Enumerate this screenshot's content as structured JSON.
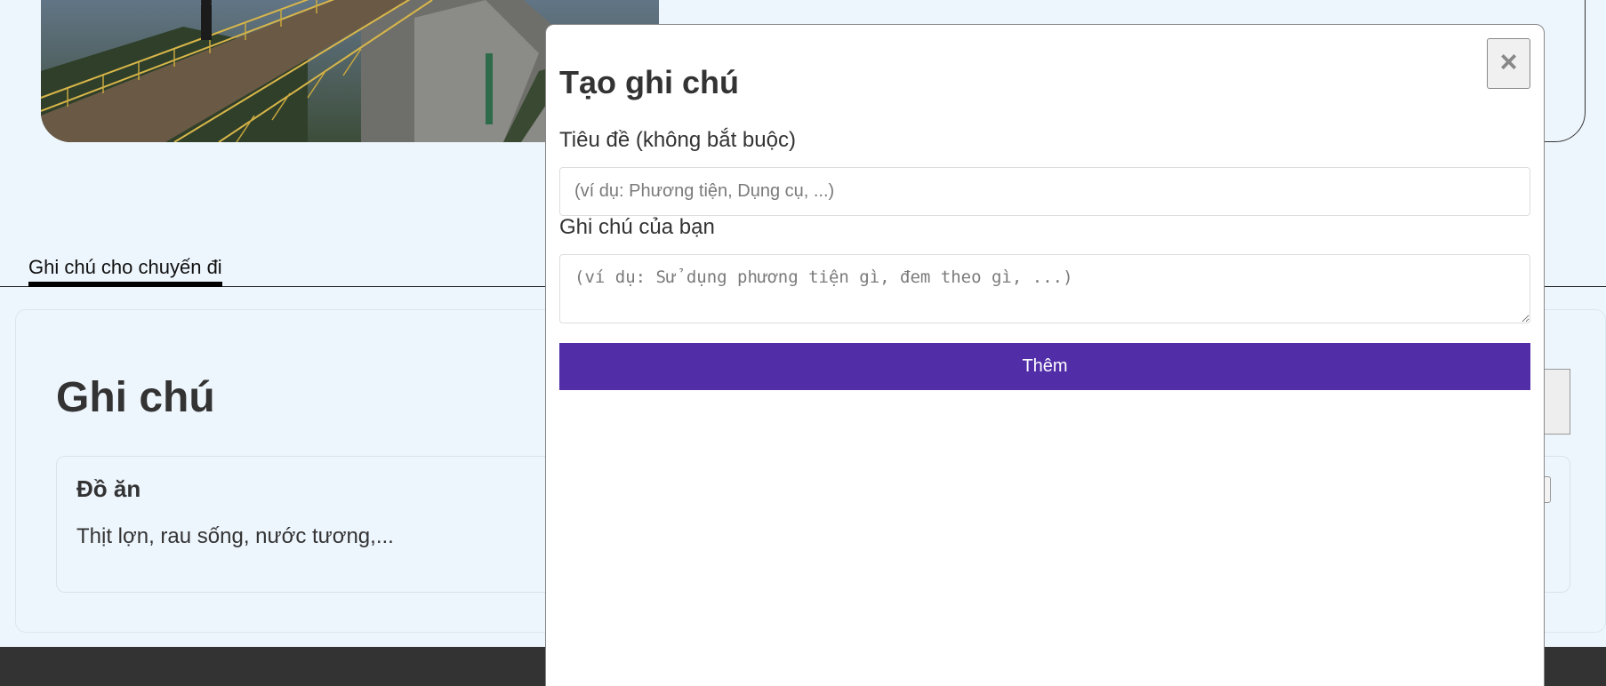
{
  "colors": {
    "page_background": "#eef6fd",
    "primary_button": "#512da8",
    "footer": "#333333",
    "text": "#333333"
  },
  "tabs": [
    {
      "label": "Ghi chú cho chuyến đi",
      "active": true
    }
  ],
  "notes": {
    "heading": "Ghi chú",
    "items": [
      {
        "title": "Đồ ăn",
        "body": "Thịt lợn, rau sống, nước tương,..."
      }
    ]
  },
  "modal": {
    "title": "Tạo ghi chú",
    "close_icon": "×",
    "title_field": {
      "label": "Tiêu đề (không bắt buộc)",
      "value": "",
      "placeholder": "(ví dụ: Phương tiện, Dụng cụ, ...)"
    },
    "note_field": {
      "label": "Ghi chú của bạn",
      "value": "",
      "placeholder": "(ví dụ: Sử dụng phương tiện gì, đem theo gì, ...)"
    },
    "submit_label": "Thêm"
  }
}
